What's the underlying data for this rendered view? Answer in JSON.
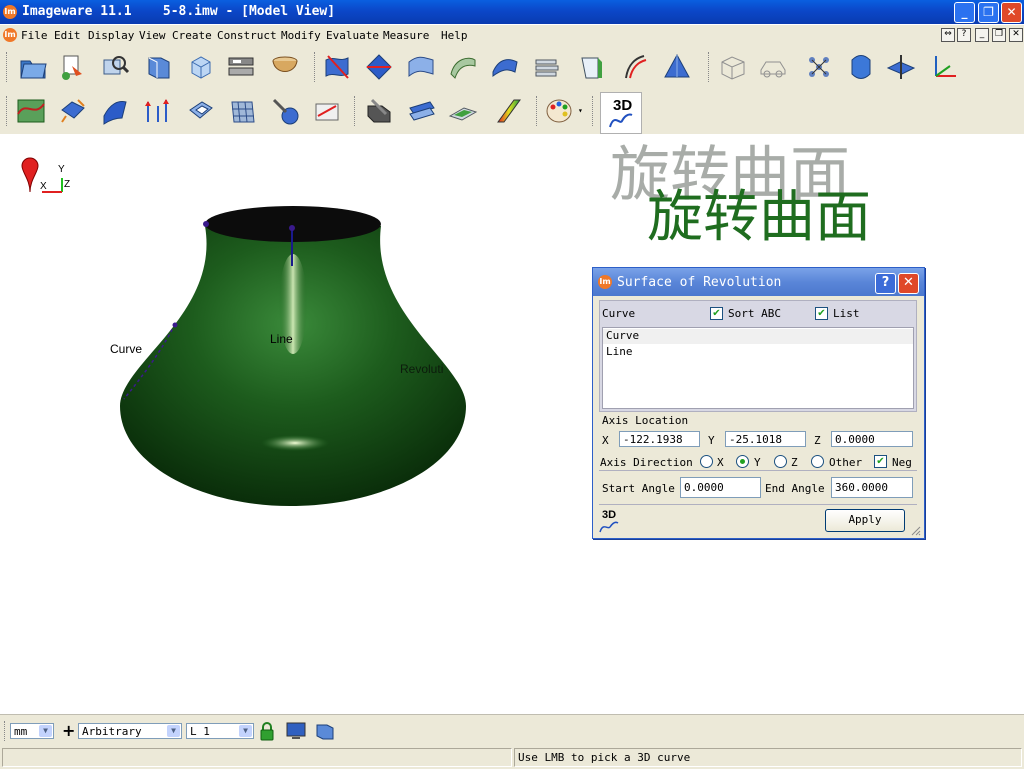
{
  "window": {
    "title": "Imageware 11.1    5-8.imw - [Model View]",
    "app_icon": "Im"
  },
  "menu": {
    "items": [
      "File",
      "Edit",
      "Display",
      "View",
      "Create",
      "Construct",
      "Modify",
      "Evaluate",
      "Measure",
      "Help"
    ]
  },
  "toolbar": {
    "row1_icons": [
      "open-file-icon",
      "import-icon",
      "inspect-icon",
      "view-plane-icon",
      "cube-view-icon",
      "layers-icon",
      "bowl-surface-icon",
      "surface-edit-icon",
      "surface-diamond-icon",
      "surface-sweep-icon",
      "surface-blend-icon",
      "surface-patch-icon",
      "surface-loft-icon",
      "surface-extend-icon",
      "surface-offset-icon",
      "pyramid-icon",
      "wireframe-box-icon",
      "wireframe-car-icon",
      "network-icon",
      "solid-shape-icon",
      "plane-icon",
      "axis-icon"
    ],
    "row2_icons": [
      "curve-surface-icon",
      "transform-icon",
      "fillet-icon",
      "normal-arrows-icon",
      "trim-icon",
      "grid-patch-icon",
      "probe-icon",
      "measure-icon",
      "cut-icon",
      "extrude-icon",
      "shell-icon",
      "color-map-icon",
      "palette-icon",
      "3d-curve-icon"
    ],
    "badge_3d": "3D"
  },
  "viewport": {
    "watermark_gray": "旋转曲面",
    "watermark_green": "旋转曲面",
    "axis": {
      "y": "Y",
      "x": "X",
      "z": "Z"
    },
    "labels": {
      "curve": "Curve",
      "line": "Line",
      "revolution": "Revolution"
    }
  },
  "dialog": {
    "title": "Surface of Revolution",
    "curve_label": "Curve",
    "sort_abc_label": "Sort ABC",
    "sort_abc_checked": true,
    "list_label": "List",
    "list_checked": true,
    "list_items": [
      "Curve",
      "Line"
    ],
    "selected_item": "Curve",
    "axis_location_label": "Axis Location",
    "x_label": "X",
    "x_value": "-122.1938",
    "y_label": "Y",
    "y_value": "-25.1018",
    "z_label": "Z",
    "z_value": "0.0000",
    "axis_direction_label": "Axis Direction",
    "dir_options": [
      "X",
      "Y",
      "Z",
      "Other"
    ],
    "dir_selected": "Y",
    "neg_label": "Neg",
    "neg_checked": true,
    "start_angle_label": "Start Angle",
    "start_angle_value": "0.0000",
    "end_angle_label": "End Angle",
    "end_angle_value": "360.0000",
    "apply_label": "Apply",
    "badge_3d": "3D"
  },
  "bottom": {
    "units": "mm",
    "plus": "+",
    "snap_mode": "Arbitrary",
    "layer": "L 1",
    "status_message": "Use LMB to pick a 3D curve"
  },
  "colors": {
    "title_bar": "#0b47c8",
    "surface_dark": "#0c3a0c",
    "surface_light": "#2f7a2f",
    "watermark_green": "#1f6d1f",
    "watermark_gray": "#a8aca8"
  }
}
